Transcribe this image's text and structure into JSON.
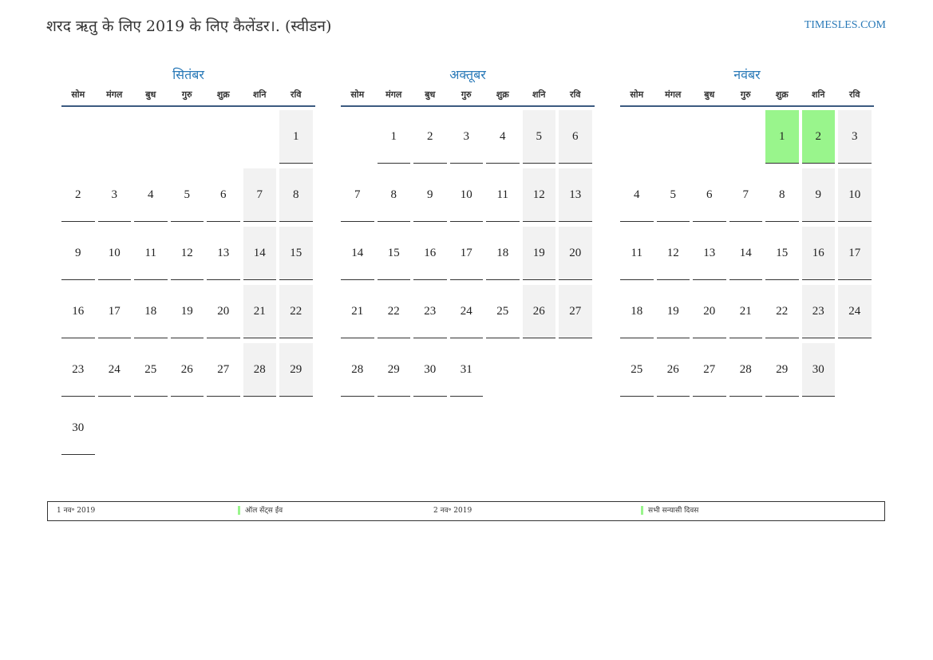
{
  "header": {
    "title": "शरद ऋतु के लिए 2019 के लिए कैलेंडर।. (स्वीडन)",
    "site": "TIMESLES.COM"
  },
  "weekdays": [
    "सोम",
    "मंगल",
    "बुध",
    "गुरु",
    "शुक्र",
    "शनि",
    "रवि"
  ],
  "colors": {
    "accent": "#2a7ab8",
    "holiday": "#99f58c",
    "weekend": "#f2f2f2",
    "rule": "#3c5a80"
  },
  "months": [
    {
      "name": "सितंबर",
      "days": [
        "",
        "",
        "",
        "",
        "",
        "",
        "1",
        "2",
        "3",
        "4",
        "5",
        "6",
        "7",
        "8",
        "9",
        "10",
        "11",
        "12",
        "13",
        "14",
        "15",
        "16",
        "17",
        "18",
        "19",
        "20",
        "21",
        "22",
        "23",
        "24",
        "25",
        "26",
        "27",
        "28",
        "29",
        "30"
      ],
      "holidays": []
    },
    {
      "name": "अक्तूबर",
      "days": [
        "",
        "1",
        "2",
        "3",
        "4",
        "5",
        "6",
        "7",
        "8",
        "9",
        "10",
        "11",
        "12",
        "13",
        "14",
        "15",
        "16",
        "17",
        "18",
        "19",
        "20",
        "21",
        "22",
        "23",
        "24",
        "25",
        "26",
        "27",
        "28",
        "29",
        "30",
        "31"
      ],
      "holidays": []
    },
    {
      "name": "नवंबर",
      "days": [
        "",
        "",
        "",
        "",
        "1",
        "2",
        "3",
        "4",
        "5",
        "6",
        "7",
        "8",
        "9",
        "10",
        "11",
        "12",
        "13",
        "14",
        "15",
        "16",
        "17",
        "18",
        "19",
        "20",
        "21",
        "22",
        "23",
        "24",
        "25",
        "26",
        "27",
        "28",
        "29",
        "30"
      ],
      "holidays": [
        "1",
        "2"
      ]
    }
  ],
  "legend": [
    {
      "date": "1 नव॰ 2019",
      "name": "ऑल सेंट्स ईव"
    },
    {
      "date": "2 नव॰ 2019",
      "name": "सभी सन्यासी दिवस"
    }
  ]
}
